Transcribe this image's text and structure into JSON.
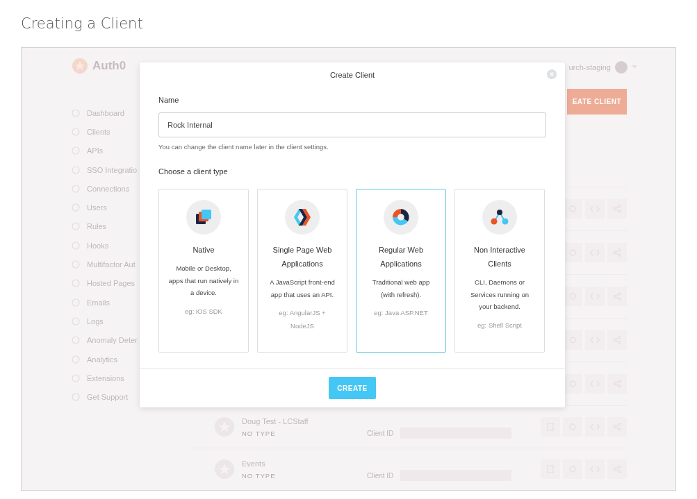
{
  "page_title": "Creating a Client",
  "background": {
    "logo": "Auth0",
    "sidebar": [
      {
        "label": "Dashboard"
      },
      {
        "label": "Clients"
      },
      {
        "label": "APIs"
      },
      {
        "label": "SSO Integratio"
      },
      {
        "label": "Connections"
      },
      {
        "label": "Users"
      },
      {
        "label": "Rules"
      },
      {
        "label": "Hooks"
      },
      {
        "label": "Multifactor Aut"
      },
      {
        "label": "Hosted Pages"
      },
      {
        "label": "Emails"
      },
      {
        "label": "Logs"
      },
      {
        "label": "Anomaly Deter"
      },
      {
        "label": "Analytics"
      },
      {
        "label": "Extensions"
      },
      {
        "label": "Get Support"
      }
    ],
    "tenant": "urch-staging",
    "create_button": "EATE CLIENT",
    "rows": [
      {
        "name": "Doug Test - LCStaff",
        "type": "NO TYPE",
        "id_label": "Client ID"
      },
      {
        "name": "Events",
        "type": "NO TYPE",
        "id_label": "Client ID"
      }
    ]
  },
  "modal": {
    "title": "Create Client",
    "name_label": "Name",
    "name_value": "Rock Internal",
    "name_help": "You can change the client name later in the client settings.",
    "type_label": "Choose a client type",
    "client_types": [
      {
        "kind": "native",
        "title": "Native",
        "description": "Mobile or Desktop, apps that run natively in a device.",
        "example": "eg: iOS SDK",
        "selected": false
      },
      {
        "kind": "spa",
        "title": "Single Page Web Applications",
        "description": "A JavaScript front-end app that uses an API.",
        "example": "eg: AngularJS + NodeJS",
        "selected": false
      },
      {
        "kind": "regular",
        "title": "Regular Web Applications",
        "description": "Traditional web app (with refresh).",
        "example": "eg: Java ASP.NET",
        "selected": true
      },
      {
        "kind": "non_interactive",
        "title": "Non Interactive Clients",
        "description": "CLI, Daemons or Services running on your backend.",
        "example": "eg: Shell Script",
        "selected": false
      }
    ],
    "submit": "CREATE"
  }
}
